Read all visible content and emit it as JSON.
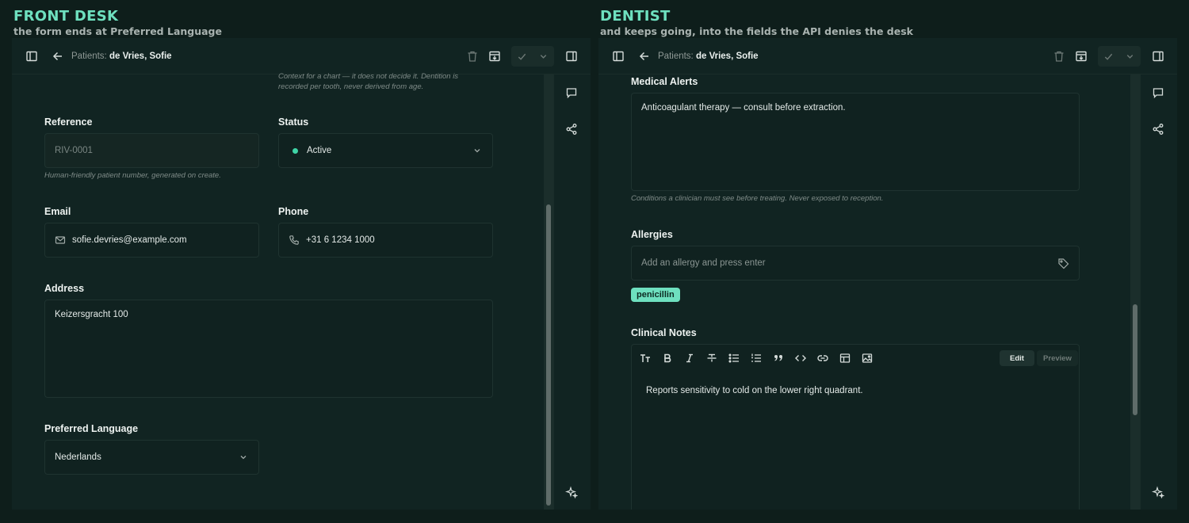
{
  "left": {
    "caption_title": "FRONT DESK",
    "caption_sub": "the form ends at Preferred Language",
    "crumb_key": "Patients:",
    "crumb_value": "de Vries, Sofie",
    "dentition_help": "Context for a chart — it does not decide it. Dentition is recorded per tooth, never derived from age.",
    "reference_label": "Reference",
    "reference_value": "RIV-0001",
    "reference_help": "Human-friendly patient number, generated on create.",
    "status_label": "Status",
    "status_value": "Active",
    "email_label": "Email",
    "email_value": "sofie.devries@example.com",
    "phone_label": "Phone",
    "phone_value": "+31 6 1234 1000",
    "address_label": "Address",
    "address_value": "Keizersgracht 100",
    "language_label": "Preferred Language",
    "language_value": "Nederlands"
  },
  "right": {
    "caption_title": "DENTIST",
    "caption_sub": "and keeps going, into the fields the API denies the desk",
    "crumb_key": "Patients:",
    "crumb_value": "de Vries, Sofie",
    "alerts_label": "Medical Alerts",
    "alerts_value": "Anticoagulant therapy — consult before extraction.",
    "alerts_help": "Conditions a clinician must see before treating. Never exposed to reception.",
    "allergies_label": "Allergies",
    "allergies_placeholder": "Add an allergy and press enter",
    "allergy_chip": "penicillin",
    "notes_label": "Clinical Notes",
    "edit_label": "Edit",
    "preview_label": "Preview",
    "notes_value": "Reports sensitivity to cold on the lower right quadrant."
  },
  "colors": {
    "accent": "#6ee0bf",
    "status_active": "#3fd4a6",
    "panel_bg": "#112422",
    "page_bg": "#0e1e1b"
  },
  "icons": {
    "toolbar": [
      "sidebar-left-icon",
      "back-arrow-icon",
      "trash-icon",
      "archive-icon",
      "check-icon",
      "chevron-down-icon",
      "sidebar-right-icon"
    ],
    "rail": [
      "comment-icon",
      "share-icon",
      "sparkle-icon"
    ],
    "editor": [
      "heading-icon",
      "bold-icon",
      "italic-icon",
      "strikethrough-icon",
      "bullet-list-icon",
      "ordered-list-icon",
      "quote-icon",
      "code-icon",
      "link-icon",
      "table-icon",
      "image-icon"
    ]
  }
}
